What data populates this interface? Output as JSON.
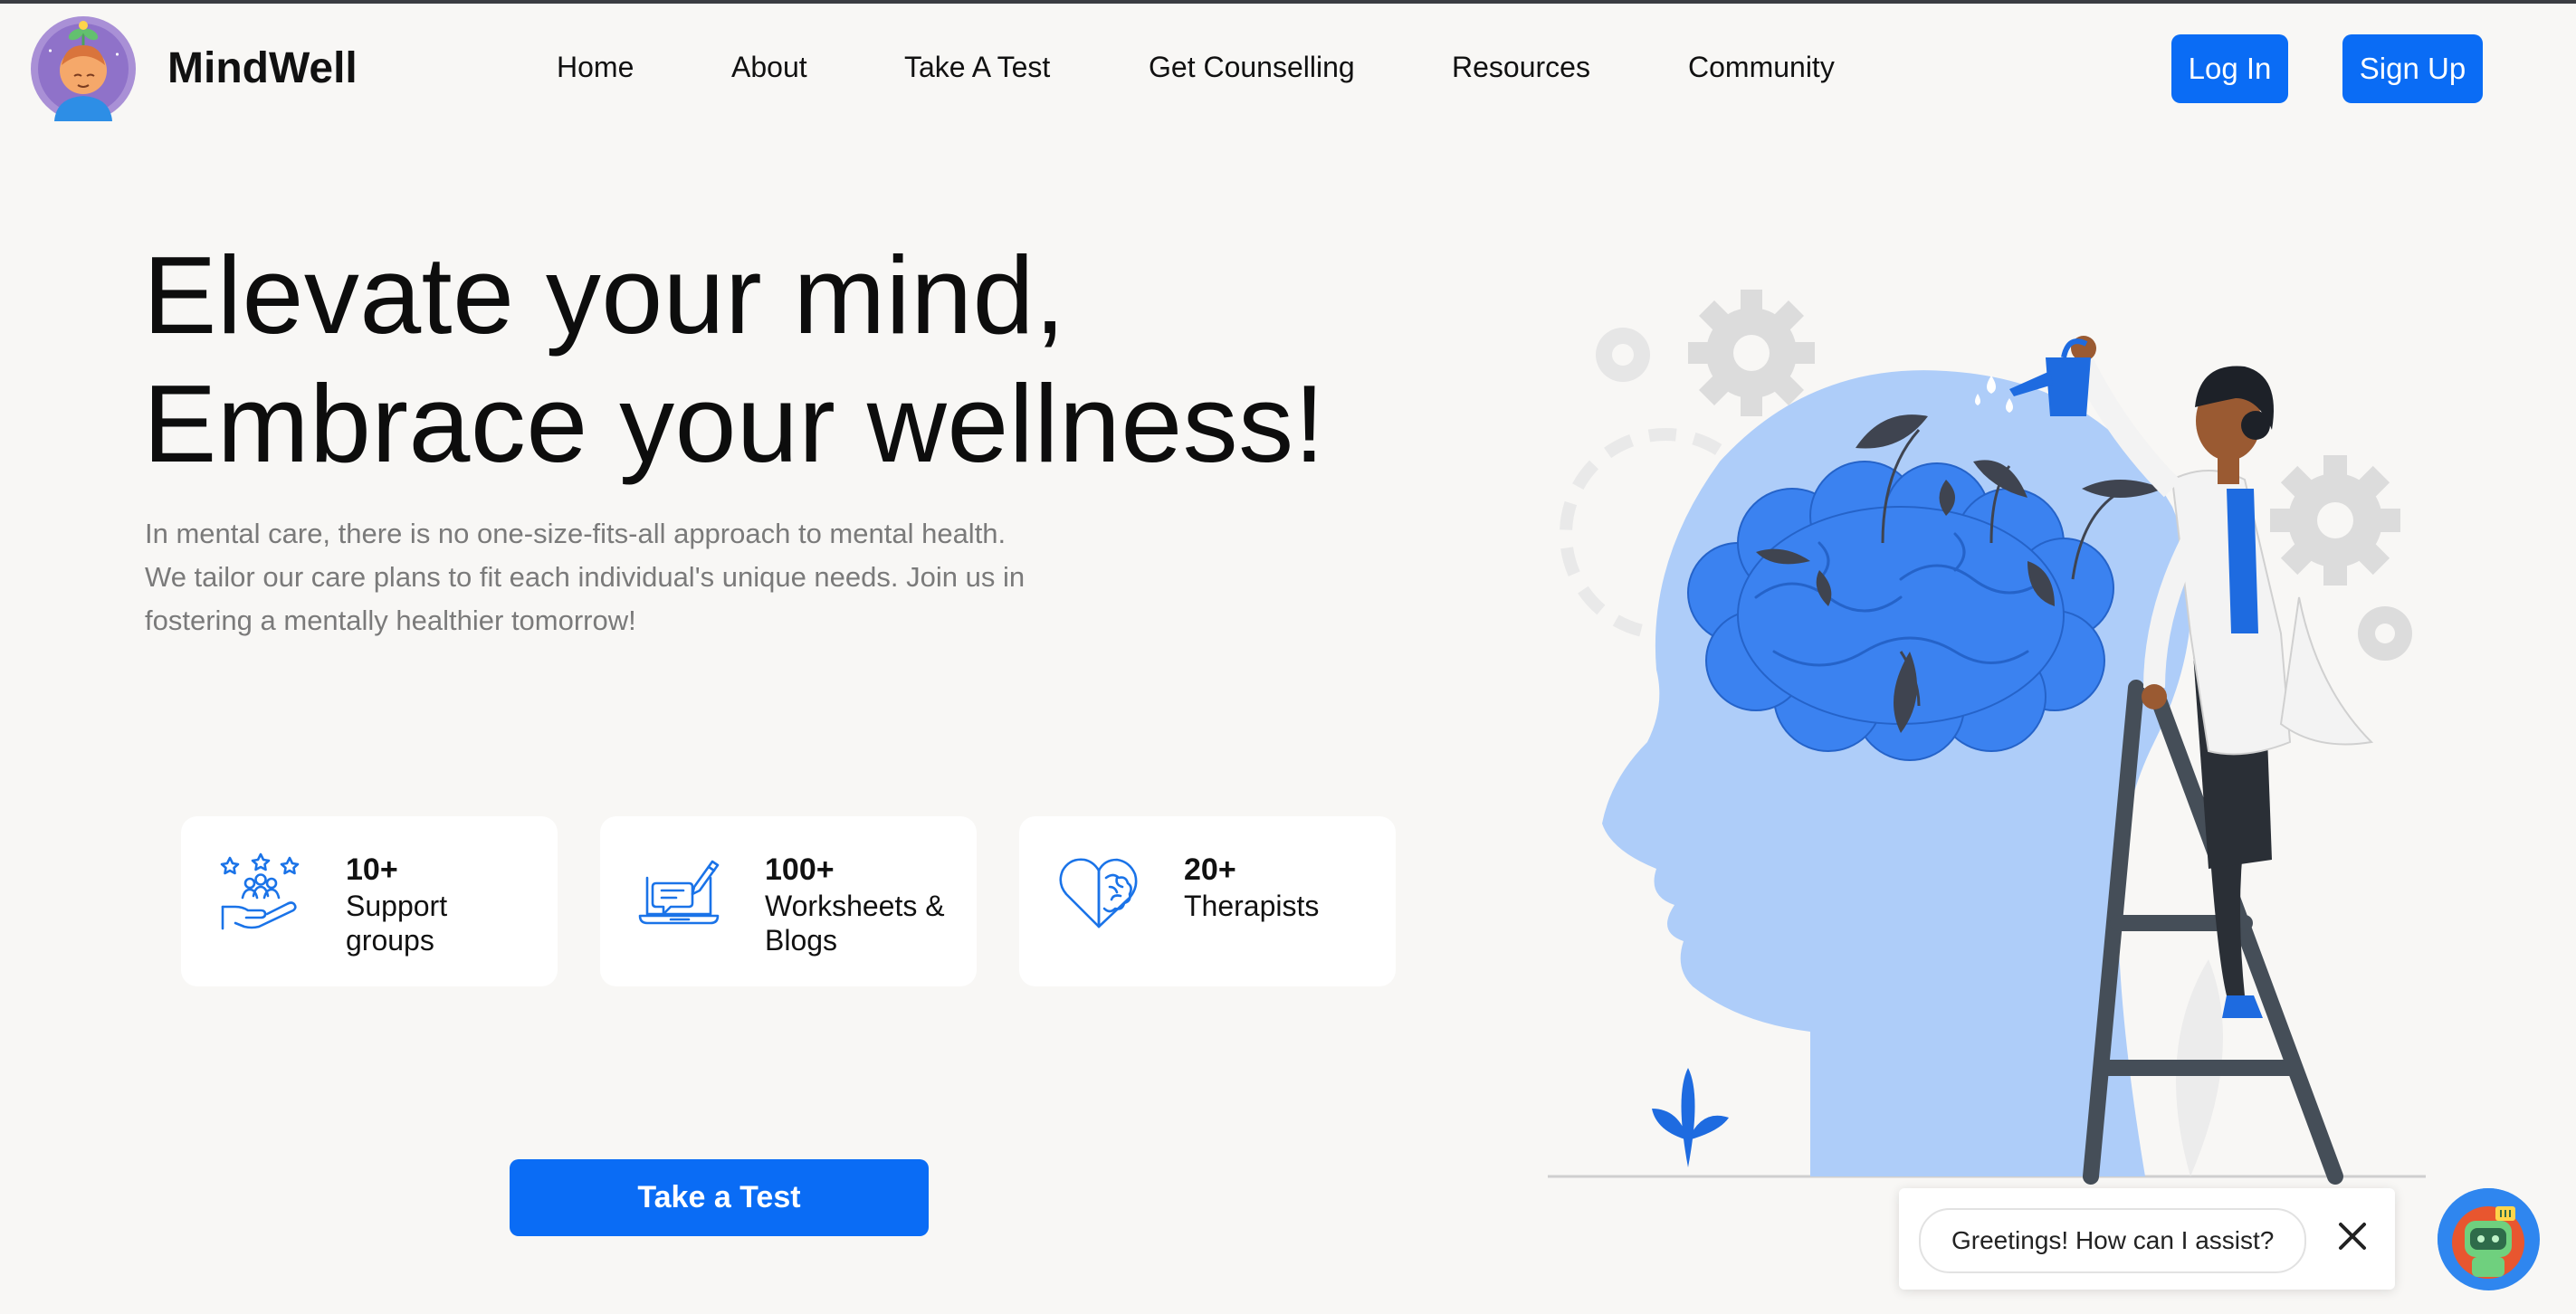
{
  "brand": {
    "name": "MindWell",
    "logo_icon": "meditating-person-icon"
  },
  "nav": {
    "items": [
      {
        "label": "Home"
      },
      {
        "label": "About"
      },
      {
        "label": "Take A Test"
      },
      {
        "label": "Get Counselling"
      },
      {
        "label": "Resources"
      },
      {
        "label": "Community"
      }
    ],
    "login_label": "Log In",
    "signup_label": "Sign Up"
  },
  "hero": {
    "title_line1": "Elevate your mind,",
    "title_line2": "Embrace your wellness!",
    "description_lines": [
      "In mental care, there is no one-size-fits-all approach to mental health.",
      "We tailor our care plans to fit each individual's unique needs. Join us in",
      "fostering a mentally healthier tomorrow!"
    ],
    "cta_label": "Take a Test"
  },
  "stats": [
    {
      "number": "10+",
      "label_line1": "Support",
      "label_line2": "groups",
      "icon": "support-group-hand-icon"
    },
    {
      "number": "100+",
      "label_line1": "Worksheets &",
      "label_line2": "Blogs",
      "icon": "laptop-writing-icon"
    },
    {
      "number": "20+",
      "label_line1": "Therapists",
      "label_line2": "",
      "icon": "heart-brain-icon"
    }
  ],
  "chat": {
    "greeting": "Greetings! How can I assist?",
    "close_icon": "close-icon",
    "bot_icon": "robot-icon"
  },
  "colors": {
    "accent": "#0a6cf5",
    "background": "#f8f7f5",
    "illustration_light": "#aecdf9",
    "illustration_brain": "#3b82f0"
  }
}
